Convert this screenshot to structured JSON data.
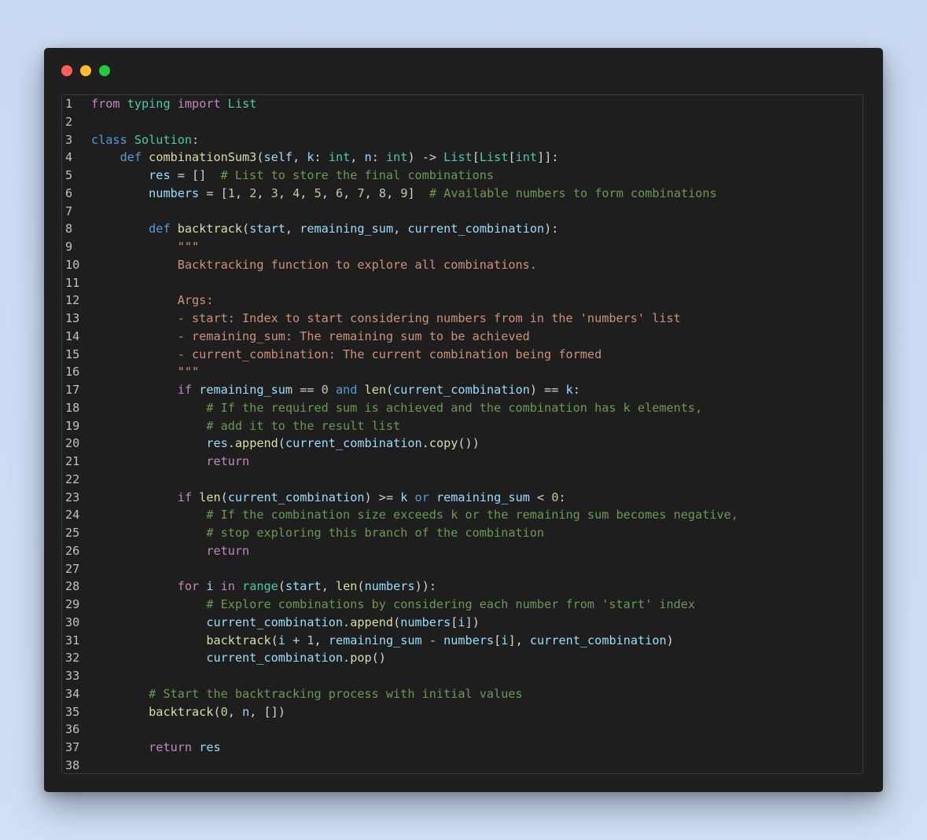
{
  "window": {
    "traffic_lights": [
      {
        "name": "close",
        "color": "#ff5f57"
      },
      {
        "name": "minimize",
        "color": "#febc2e"
      },
      {
        "name": "maximize",
        "color": "#28c840"
      }
    ]
  },
  "colors": {
    "keyword": "#c586c0",
    "storage": "#569cd6",
    "function": "#dcdcaa",
    "class": "#4ec9b0",
    "variable": "#9cdcfe",
    "number": "#b5cea8",
    "string": "#ce9178",
    "comment": "#6a9955",
    "plain": "#d4d4d4"
  },
  "code": {
    "lines": [
      {
        "n": "1",
        "tokens": [
          [
            "kw",
            "from"
          ],
          [
            "op",
            " "
          ],
          [
            "cls",
            "typing"
          ],
          [
            "op",
            " "
          ],
          [
            "kw",
            "import"
          ],
          [
            "op",
            " "
          ],
          [
            "cls",
            "List"
          ]
        ]
      },
      {
        "n": "2",
        "tokens": []
      },
      {
        "n": "3",
        "tokens": [
          [
            "kb",
            "class"
          ],
          [
            "op",
            " "
          ],
          [
            "cls",
            "Solution"
          ],
          [
            "op",
            ":"
          ]
        ]
      },
      {
        "n": "4",
        "tokens": [
          [
            "op",
            "    "
          ],
          [
            "kb",
            "def"
          ],
          [
            "op",
            " "
          ],
          [
            "fn",
            "combinationSum3"
          ],
          [
            "op",
            "("
          ],
          [
            "var",
            "self"
          ],
          [
            "op",
            ", "
          ],
          [
            "var",
            "k"
          ],
          [
            "op",
            ": "
          ],
          [
            "cls",
            "int"
          ],
          [
            "op",
            ", "
          ],
          [
            "var",
            "n"
          ],
          [
            "op",
            ": "
          ],
          [
            "cls",
            "int"
          ],
          [
            "op",
            ") -> "
          ],
          [
            "cls",
            "List"
          ],
          [
            "op",
            "["
          ],
          [
            "cls",
            "List"
          ],
          [
            "op",
            "["
          ],
          [
            "cls",
            "int"
          ],
          [
            "op",
            "]]:"
          ]
        ]
      },
      {
        "n": "5",
        "tokens": [
          [
            "op",
            "        "
          ],
          [
            "var",
            "res"
          ],
          [
            "op",
            " = []  "
          ],
          [
            "cm",
            "# List to store the final combinations"
          ]
        ]
      },
      {
        "n": "6",
        "tokens": [
          [
            "op",
            "        "
          ],
          [
            "var",
            "numbers"
          ],
          [
            "op",
            " = ["
          ],
          [
            "num",
            "1"
          ],
          [
            "op",
            ", "
          ],
          [
            "num",
            "2"
          ],
          [
            "op",
            ", "
          ],
          [
            "num",
            "3"
          ],
          [
            "op",
            ", "
          ],
          [
            "num",
            "4"
          ],
          [
            "op",
            ", "
          ],
          [
            "num",
            "5"
          ],
          [
            "op",
            ", "
          ],
          [
            "num",
            "6"
          ],
          [
            "op",
            ", "
          ],
          [
            "num",
            "7"
          ],
          [
            "op",
            ", "
          ],
          [
            "num",
            "8"
          ],
          [
            "op",
            ", "
          ],
          [
            "num",
            "9"
          ],
          [
            "op",
            "]  "
          ],
          [
            "cm",
            "# Available numbers to form combinations"
          ]
        ]
      },
      {
        "n": "7",
        "tokens": []
      },
      {
        "n": "8",
        "tokens": [
          [
            "op",
            "        "
          ],
          [
            "kb",
            "def"
          ],
          [
            "op",
            " "
          ],
          [
            "fn",
            "backtrack"
          ],
          [
            "op",
            "("
          ],
          [
            "var",
            "start"
          ],
          [
            "op",
            ", "
          ],
          [
            "var",
            "remaining_sum"
          ],
          [
            "op",
            ", "
          ],
          [
            "var",
            "current_combination"
          ],
          [
            "op",
            "):"
          ]
        ]
      },
      {
        "n": "9",
        "tokens": [
          [
            "op",
            "            "
          ],
          [
            "str",
            "\"\"\""
          ]
        ]
      },
      {
        "n": "10",
        "tokens": [
          [
            "op",
            "            "
          ],
          [
            "str",
            "Backtracking function to explore all combinations."
          ]
        ]
      },
      {
        "n": "11",
        "tokens": []
      },
      {
        "n": "12",
        "tokens": [
          [
            "op",
            "            "
          ],
          [
            "str",
            "Args:"
          ]
        ]
      },
      {
        "n": "13",
        "tokens": [
          [
            "op",
            "            "
          ],
          [
            "str",
            "- start: Index to start considering numbers from in the 'numbers' list"
          ]
        ]
      },
      {
        "n": "14",
        "tokens": [
          [
            "op",
            "            "
          ],
          [
            "str",
            "- remaining_sum: The remaining sum to be achieved"
          ]
        ]
      },
      {
        "n": "15",
        "tokens": [
          [
            "op",
            "            "
          ],
          [
            "str",
            "- current_combination: The current combination being formed"
          ]
        ]
      },
      {
        "n": "16",
        "tokens": [
          [
            "op",
            "            "
          ],
          [
            "str",
            "\"\"\""
          ]
        ]
      },
      {
        "n": "17",
        "tokens": [
          [
            "op",
            "            "
          ],
          [
            "kw",
            "if"
          ],
          [
            "op",
            " "
          ],
          [
            "var",
            "remaining_sum"
          ],
          [
            "op",
            " == "
          ],
          [
            "num",
            "0"
          ],
          [
            "op",
            " "
          ],
          [
            "kb",
            "and"
          ],
          [
            "op",
            " "
          ],
          [
            "fn",
            "len"
          ],
          [
            "op",
            "("
          ],
          [
            "var",
            "current_combination"
          ],
          [
            "op",
            ") == "
          ],
          [
            "var",
            "k"
          ],
          [
            "op",
            ":"
          ]
        ]
      },
      {
        "n": "18",
        "tokens": [
          [
            "op",
            "                "
          ],
          [
            "cm",
            "# If the required sum is achieved and the combination has k elements,"
          ]
        ]
      },
      {
        "n": "19",
        "tokens": [
          [
            "op",
            "                "
          ],
          [
            "cm",
            "# add it to the result list"
          ]
        ]
      },
      {
        "n": "20",
        "tokens": [
          [
            "op",
            "                "
          ],
          [
            "var",
            "res"
          ],
          [
            "op",
            "."
          ],
          [
            "fn",
            "append"
          ],
          [
            "op",
            "("
          ],
          [
            "var",
            "current_combination"
          ],
          [
            "op",
            "."
          ],
          [
            "fn",
            "copy"
          ],
          [
            "op",
            "())"
          ]
        ]
      },
      {
        "n": "21",
        "tokens": [
          [
            "op",
            "                "
          ],
          [
            "kw",
            "return"
          ]
        ]
      },
      {
        "n": "22",
        "tokens": []
      },
      {
        "n": "23",
        "tokens": [
          [
            "op",
            "            "
          ],
          [
            "kw",
            "if"
          ],
          [
            "op",
            " "
          ],
          [
            "fn",
            "len"
          ],
          [
            "op",
            "("
          ],
          [
            "var",
            "current_combination"
          ],
          [
            "op",
            ") >= "
          ],
          [
            "var",
            "k"
          ],
          [
            "op",
            " "
          ],
          [
            "kb",
            "or"
          ],
          [
            "op",
            " "
          ],
          [
            "var",
            "remaining_sum"
          ],
          [
            "op",
            " < "
          ],
          [
            "num",
            "0"
          ],
          [
            "op",
            ":"
          ]
        ]
      },
      {
        "n": "24",
        "tokens": [
          [
            "op",
            "                "
          ],
          [
            "cm",
            "# If the combination size exceeds k or the remaining sum becomes negative,"
          ]
        ]
      },
      {
        "n": "25",
        "tokens": [
          [
            "op",
            "                "
          ],
          [
            "cm",
            "# stop exploring this branch of the combination"
          ]
        ]
      },
      {
        "n": "26",
        "tokens": [
          [
            "op",
            "                "
          ],
          [
            "kw",
            "return"
          ]
        ]
      },
      {
        "n": "27",
        "tokens": []
      },
      {
        "n": "28",
        "tokens": [
          [
            "op",
            "            "
          ],
          [
            "kw",
            "for"
          ],
          [
            "op",
            " "
          ],
          [
            "var",
            "i"
          ],
          [
            "op",
            " "
          ],
          [
            "kw",
            "in"
          ],
          [
            "op",
            " "
          ],
          [
            "cls",
            "range"
          ],
          [
            "op",
            "("
          ],
          [
            "var",
            "start"
          ],
          [
            "op",
            ", "
          ],
          [
            "fn",
            "len"
          ],
          [
            "op",
            "("
          ],
          [
            "var",
            "numbers"
          ],
          [
            "op",
            "))"
          ],
          [
            "op",
            ":"
          ]
        ]
      },
      {
        "n": "29",
        "tokens": [
          [
            "op",
            "                "
          ],
          [
            "cm",
            "# Explore combinations by considering each number from 'start' index"
          ]
        ]
      },
      {
        "n": "30",
        "tokens": [
          [
            "op",
            "                "
          ],
          [
            "var",
            "current_combination"
          ],
          [
            "op",
            "."
          ],
          [
            "fn",
            "append"
          ],
          [
            "op",
            "("
          ],
          [
            "var",
            "numbers"
          ],
          [
            "op",
            "["
          ],
          [
            "var",
            "i"
          ],
          [
            "op",
            "])"
          ]
        ]
      },
      {
        "n": "31",
        "tokens": [
          [
            "op",
            "                "
          ],
          [
            "fn",
            "backtrack"
          ],
          [
            "op",
            "("
          ],
          [
            "var",
            "i"
          ],
          [
            "op",
            " + "
          ],
          [
            "num",
            "1"
          ],
          [
            "op",
            ", "
          ],
          [
            "var",
            "remaining_sum"
          ],
          [
            "op",
            " - "
          ],
          [
            "var",
            "numbers"
          ],
          [
            "op",
            "["
          ],
          [
            "var",
            "i"
          ],
          [
            "op",
            "], "
          ],
          [
            "var",
            "current_combination"
          ],
          [
            "op",
            ")"
          ]
        ]
      },
      {
        "n": "32",
        "tokens": [
          [
            "op",
            "                "
          ],
          [
            "var",
            "current_combination"
          ],
          [
            "op",
            "."
          ],
          [
            "fn",
            "pop"
          ],
          [
            "op",
            "()"
          ]
        ]
      },
      {
        "n": "33",
        "tokens": []
      },
      {
        "n": "34",
        "tokens": [
          [
            "op",
            "        "
          ],
          [
            "cm",
            "# Start the backtracking process with initial values"
          ]
        ]
      },
      {
        "n": "35",
        "tokens": [
          [
            "op",
            "        "
          ],
          [
            "fn",
            "backtrack"
          ],
          [
            "op",
            "("
          ],
          [
            "num",
            "0"
          ],
          [
            "op",
            ", "
          ],
          [
            "var",
            "n"
          ],
          [
            "op",
            ", [])"
          ]
        ]
      },
      {
        "n": "36",
        "tokens": []
      },
      {
        "n": "37",
        "tokens": [
          [
            "op",
            "        "
          ],
          [
            "kw",
            "return"
          ],
          [
            "op",
            " "
          ],
          [
            "var",
            "res"
          ]
        ]
      },
      {
        "n": "38",
        "tokens": []
      }
    ]
  }
}
